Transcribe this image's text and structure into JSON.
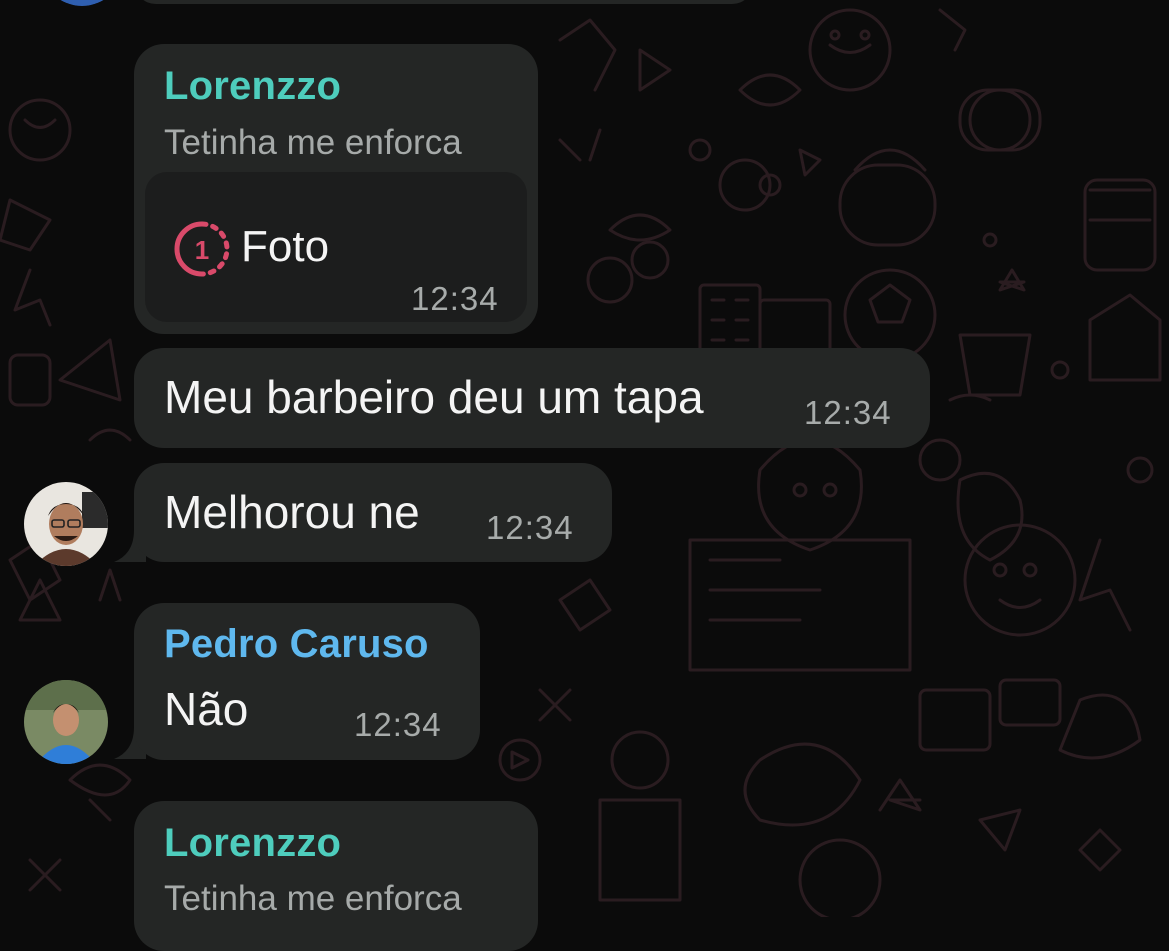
{
  "wallpaper": {
    "pattern": "doodle",
    "stroke_color": "#2a1c20"
  },
  "colors": {
    "bubble": "#242625",
    "reply_card": "#1c1d1d",
    "sender_teal": "#4ecdbd",
    "sender_blue": "#5fb8ee",
    "view_once_icon": "#d94a6a"
  },
  "messages": [
    {
      "sender": "Lorenzzo",
      "subline": "Tetinha me enforca",
      "attachment": {
        "icon": "view-once-icon",
        "badge": "1",
        "label": "Foto"
      },
      "time": "12:34"
    },
    {
      "text": "Meu barbeiro deu um tapa",
      "time": "12:34"
    },
    {
      "text": "Melhorou ne",
      "time": "12:34",
      "avatar": "avatar-user-1"
    },
    {
      "sender": "Pedro Caruso",
      "text": "Não",
      "time": "12:34",
      "avatar": "avatar-pedro-caruso"
    },
    {
      "sender": "Lorenzzo",
      "subline": "Tetinha me enforca"
    }
  ]
}
